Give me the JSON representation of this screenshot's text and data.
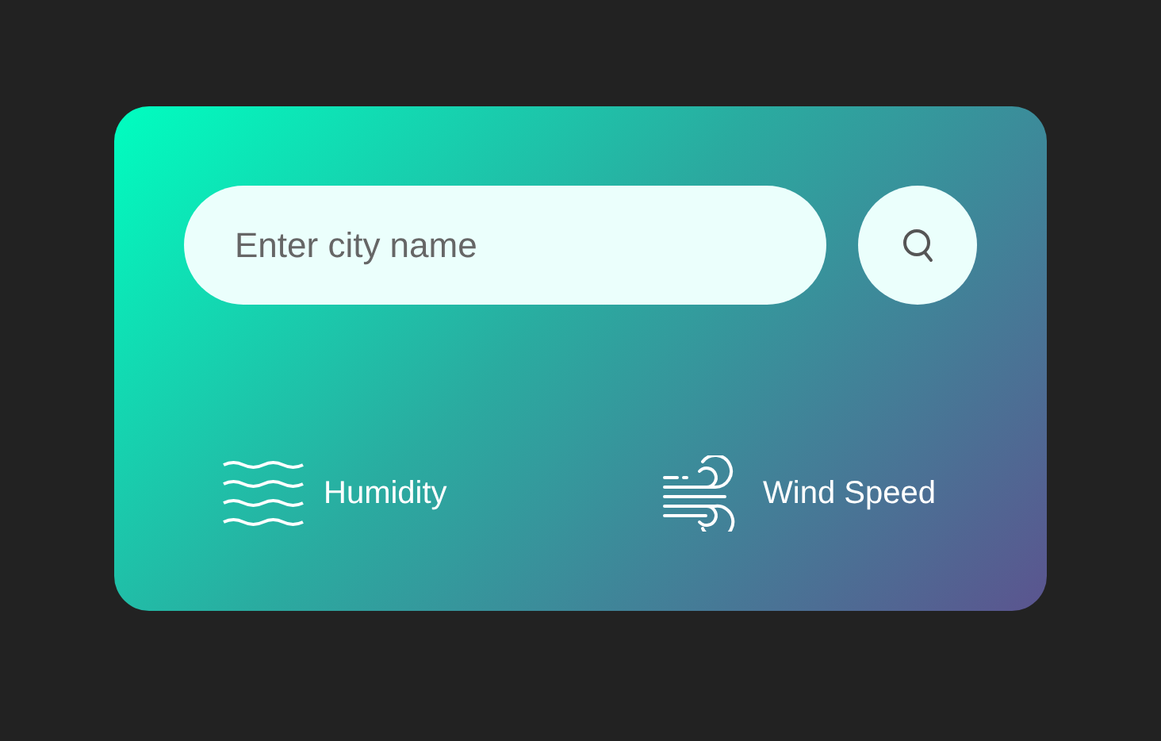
{
  "search": {
    "placeholder": "Enter city name"
  },
  "details": [
    {
      "kind": "humidity",
      "label": "Humidity"
    },
    {
      "kind": "wind",
      "label": "Wind Speed"
    }
  ]
}
